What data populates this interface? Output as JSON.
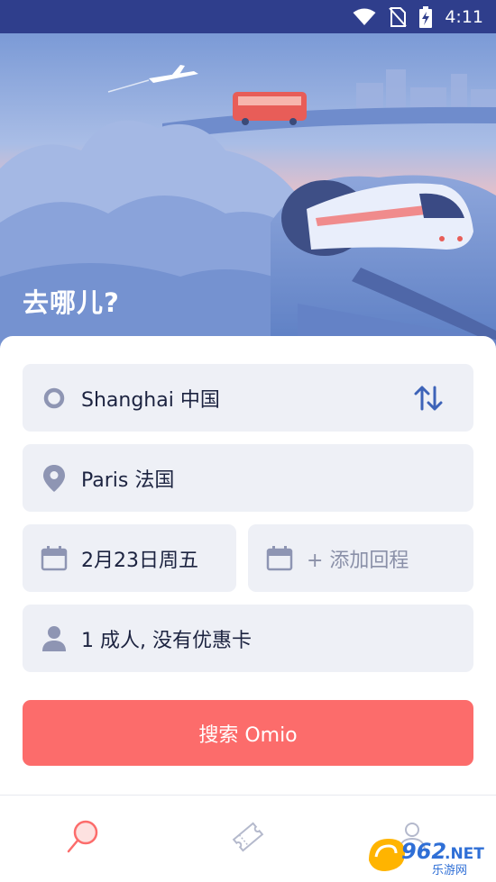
{
  "status_bar": {
    "time": "4:11",
    "icons": [
      "wifi-icon",
      "no-sim-icon",
      "battery-charging-icon"
    ]
  },
  "hero": {
    "title": "去哪儿?"
  },
  "form": {
    "origin": {
      "value": "Shanghai 中国",
      "icon": "origin-circle-icon"
    },
    "swap_icon": "swap-arrows-icon",
    "destination": {
      "value": "Paris 法国",
      "icon": "location-pin-icon"
    },
    "depart_date": {
      "value": "2月23日周五",
      "icon": "calendar-icon"
    },
    "return_date": {
      "placeholder": "+ 添加回程",
      "icon": "calendar-icon"
    },
    "passengers": {
      "value": "1 成人, 没有优惠卡",
      "icon": "person-icon"
    },
    "search_label": "搜索 Omio"
  },
  "bottom_nav": {
    "items": [
      {
        "icon": "search-magnifier-icon",
        "active": true
      },
      {
        "icon": "ticket-icon",
        "active": false
      },
      {
        "icon": "profile-icon",
        "active": false
      }
    ]
  },
  "watermark": {
    "brand": "962",
    "suffix": ".NET",
    "subtitle": "乐游网"
  },
  "colors": {
    "status_bar": "#2f3e8c",
    "accent": "#fc6c6b",
    "field_bg": "#eef0f6",
    "icon": "#8e95b3",
    "text": "#1c2340",
    "swap_icon": "#3d63b8"
  }
}
